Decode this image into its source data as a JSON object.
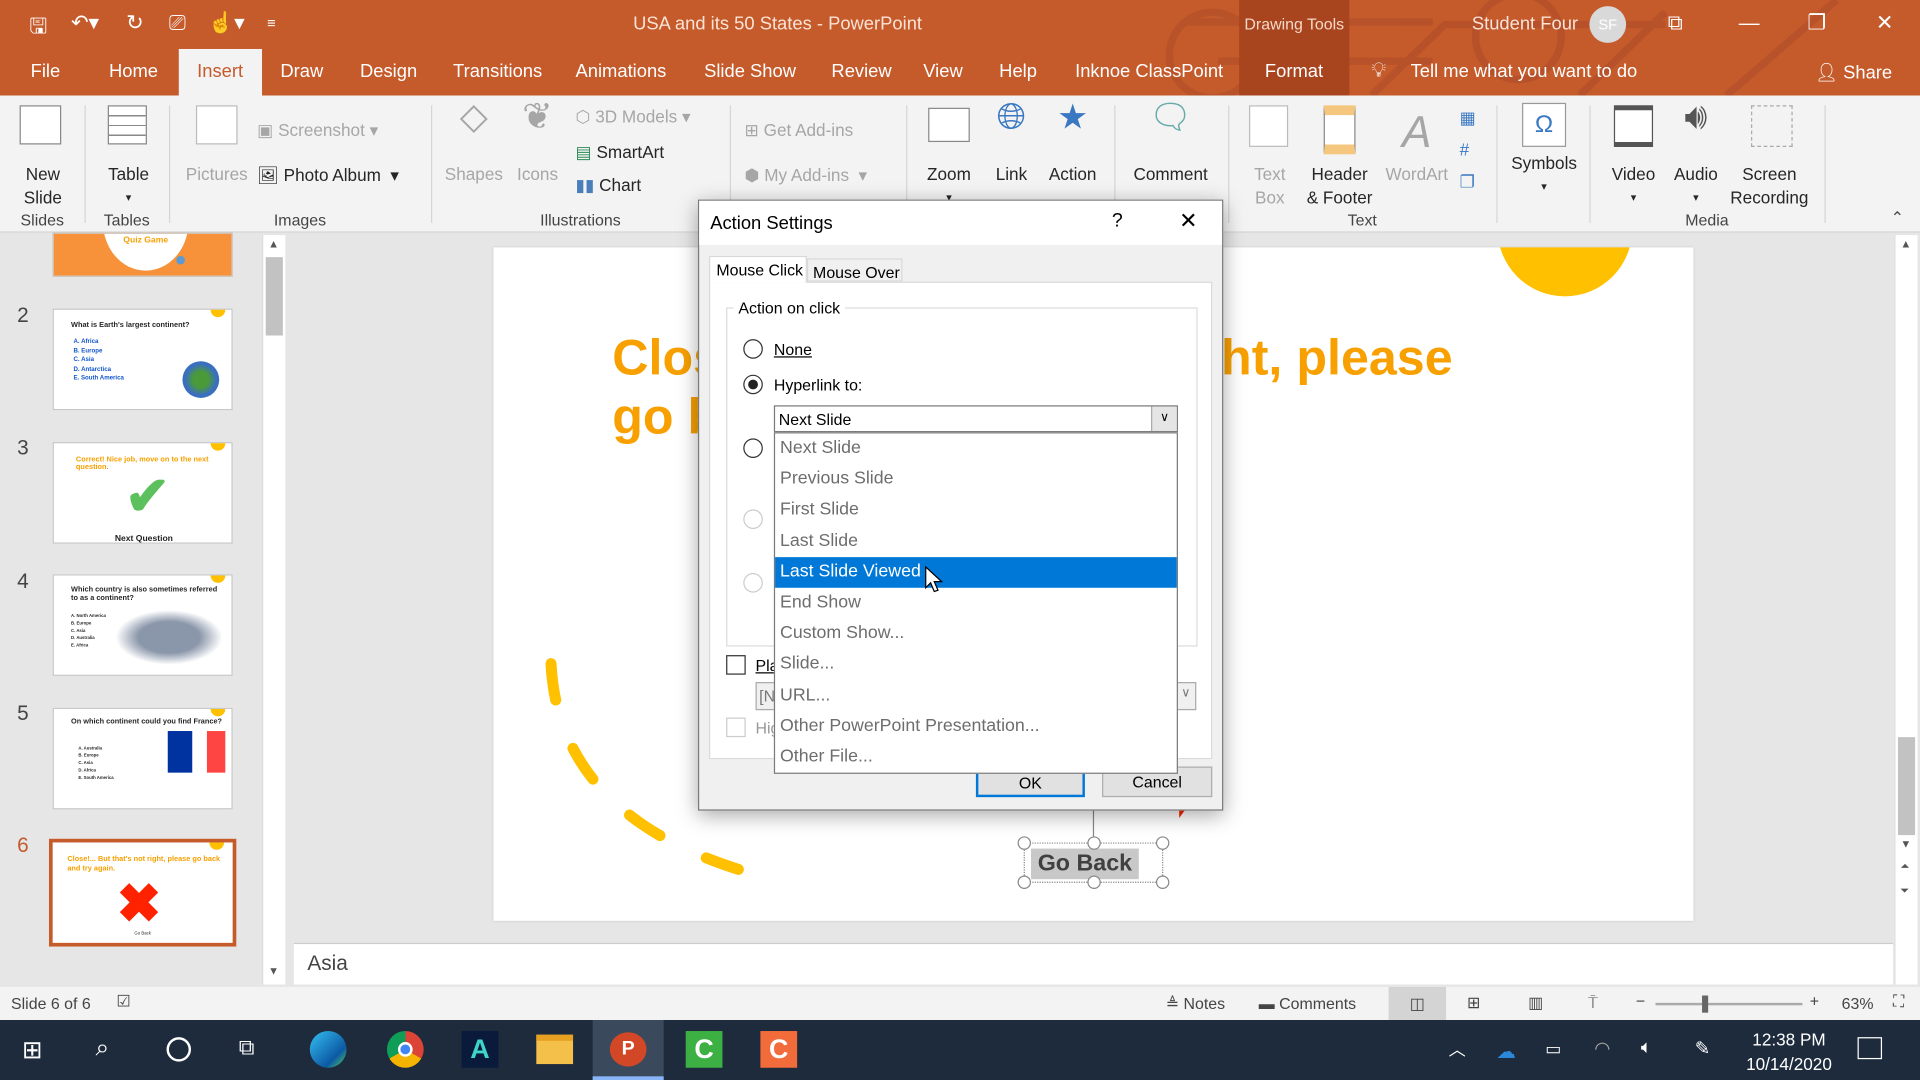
{
  "window": {
    "title": "USA and its 50 States  -  PowerPoint",
    "context_tab_group": "Drawing Tools",
    "user_name": "Student Four",
    "user_initials": "SF"
  },
  "tabs": [
    "File",
    "Home",
    "Insert",
    "Draw",
    "Design",
    "Transitions",
    "Animations",
    "Slide Show",
    "Review",
    "View",
    "Help",
    "Inknoe ClassPoint",
    "Format"
  ],
  "active_tab": "Insert",
  "tell_me": "Tell me what you want to do",
  "share": "Share",
  "ribbon": {
    "new_slide": [
      "New",
      "Slide"
    ],
    "table": "Table",
    "pictures": "Pictures",
    "screenshot": "Screenshot",
    "photo_album": "Photo Album",
    "shapes": "Shapes",
    "icons": "Icons",
    "models": "3D Models",
    "smartart": "SmartArt",
    "chart": "Chart",
    "get_addins": "Get Add-ins",
    "my_addins": "My Add-ins",
    "zoom": "Zoom",
    "link": "Link",
    "action": "Action",
    "comment": "Comment",
    "text_box": [
      "Text",
      "Box"
    ],
    "header_footer": [
      "Header",
      "& Footer"
    ],
    "wordart": "WordArt",
    "symbols": "Symbols",
    "video": "Video",
    "audio": "Audio",
    "screen_recording": [
      "Screen",
      "Recording"
    ],
    "groups": [
      "Slides",
      "Tables",
      "Images",
      "Illustrations",
      "Text",
      "Media"
    ]
  },
  "slides": {
    "numbers": [
      "2",
      "3",
      "4",
      "5",
      "6"
    ],
    "s1": "Quiz Game",
    "s2": {
      "q": "What is Earth's largest continent?",
      "a": [
        "A. Africa",
        "B. Europe",
        "C. Asia",
        "D. Antarctica",
        "E. South America"
      ]
    },
    "s3": {
      "q": "Correct! Nice job, move on to the next question.",
      "btn": "Next Question"
    },
    "s4": {
      "q": "Which country is also sometimes referred to as a continent?",
      "a": [
        "A. North America",
        "B. Europe",
        "C. Asia",
        "D. Australia",
        "E. Africa"
      ]
    },
    "s5": {
      "q": "On which continent could you find France?",
      "a": [
        "A. Australia",
        "B. Europe",
        "C. Asia",
        "D. Africa",
        "E. South America"
      ]
    },
    "s6": {
      "q": "Close!... But that's not right, please go back and try again.",
      "btn": "Go Back"
    }
  },
  "main_slide": {
    "title_line1": "Close!... But that's not right, please",
    "title_line2": "go back and try again.",
    "button": "Go Back"
  },
  "notes": "Asia",
  "status": {
    "slide": "Slide 6 of 6",
    "notes": "Notes",
    "comments": "Comments",
    "zoom": "63%",
    "zoom_fraction": 0.63
  },
  "taskbar": {
    "time": "12:38 PM",
    "date": "10/14/2020"
  },
  "dialog": {
    "title": "Action Settings",
    "help": "?",
    "tabs": [
      "Mouse Click",
      "Mouse Over"
    ],
    "group": "Action on click",
    "none": "None",
    "hyperlink": "Hyperlink to:",
    "selected_value": "Next Slide",
    "options": [
      "Next Slide",
      "Previous Slide",
      "First Slide",
      "Last Slide",
      "Last Slide Viewed",
      "End Show",
      "Custom Show...",
      "Slide...",
      "URL...",
      "Other PowerPoint Presentation...",
      "Other File..."
    ],
    "highlighted_index": 4,
    "play_sound": "Play sound:",
    "sound_value": "[No Sound]",
    "highlight_click": "Highlight click",
    "ok": "OK",
    "cancel": "Cancel"
  },
  "colors": {
    "brand": "#c55a2b",
    "selection": "#0078d7",
    "slide_title": "#f7a000",
    "accent_yellow": "#ffc000",
    "red": "#ff2200"
  }
}
